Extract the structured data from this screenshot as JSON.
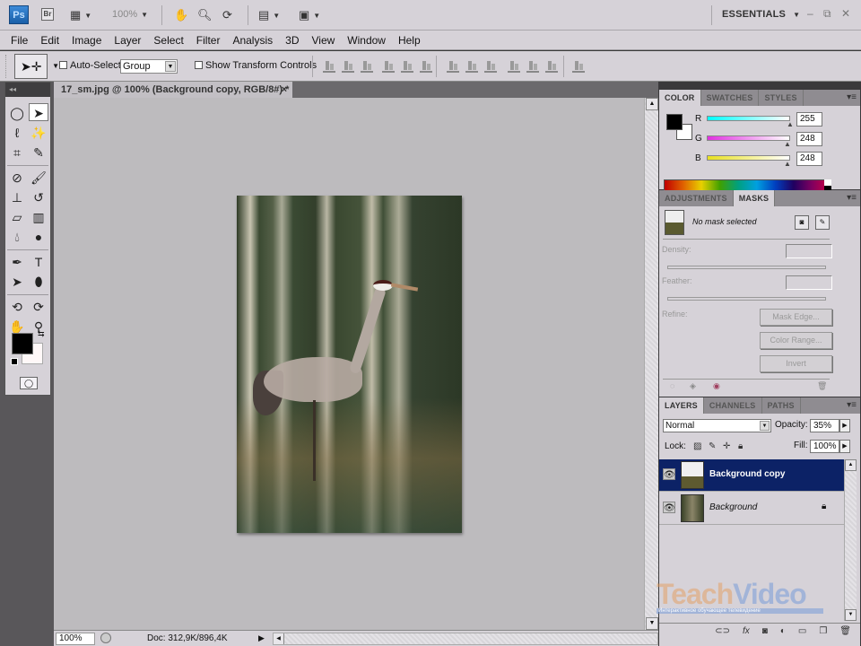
{
  "app": {
    "logo": "Ps",
    "bridge": "Br",
    "zoom_level": "100%",
    "workspace": "ESSENTIALS",
    "window_controls": [
      "minimize",
      "restore",
      "close"
    ]
  },
  "menu": [
    "File",
    "Edit",
    "Image",
    "Layer",
    "Select",
    "Filter",
    "Analysis",
    "3D",
    "View",
    "Window",
    "Help"
  ],
  "options_bar": {
    "auto_select_label": "Auto-Select:",
    "auto_select_checked": false,
    "auto_select_target": "Group",
    "show_transform_label": "Show Transform Controls",
    "show_transform_checked": false
  },
  "document": {
    "tab_title": "17_sm.jpg @ 100% (Background copy, RGB/8#) *",
    "close_label": "×",
    "image_subject": "Crane in forest"
  },
  "status": {
    "zoom": "100%",
    "doc_info": "Doc: 312,9K/896,4K"
  },
  "toolbox": {
    "collapse_label": "◂◂"
  },
  "color_panel": {
    "tabs": [
      "COLOR",
      "SWATCHES",
      "STYLES"
    ],
    "active_tab": "COLOR",
    "foreground": "#000000",
    "background": "#fff8f8",
    "channels": [
      {
        "label": "R",
        "value": "255"
      },
      {
        "label": "G",
        "value": "248"
      },
      {
        "label": "B",
        "value": "248"
      }
    ]
  },
  "masks_panel": {
    "tabs": [
      "ADJUSTMENTS",
      "MASKS"
    ],
    "active_tab": "MASKS",
    "status": "No mask selected",
    "density_label": "Density:",
    "feather_label": "Feather:",
    "refine_label": "Refine:",
    "buttons": [
      "Mask Edge...",
      "Color Range...",
      "Invert"
    ]
  },
  "layers_panel": {
    "tabs": [
      "LAYERS",
      "CHANNELS",
      "PATHS"
    ],
    "active_tab": "LAYERS",
    "blend_mode": "Normal",
    "opacity_label": "Opacity:",
    "opacity": "35%",
    "lock_label": "Lock:",
    "fill_label": "Fill:",
    "fill": "100%",
    "layers": [
      {
        "name": "Background copy",
        "selected": true,
        "visible": true,
        "locked": false
      },
      {
        "name": "Background",
        "selected": false,
        "visible": true,
        "locked": true
      }
    ]
  },
  "watermark": {
    "brand_a": "Teach",
    "brand_b": "Video",
    "tagline": "Интерактивное обучающее телевидение"
  }
}
